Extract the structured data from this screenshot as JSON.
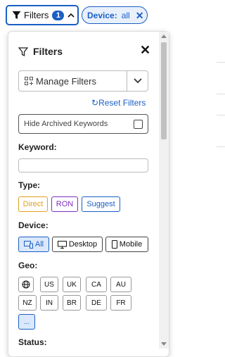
{
  "topbar": {
    "filters_label": "Filters",
    "filters_count": "1",
    "device_chip_key": "Device:",
    "device_chip_value": "all",
    "device_chip_remove": "✕"
  },
  "panel": {
    "title": "Filters",
    "close": "✕",
    "manage_filters": "Manage Filters",
    "reset_filters": "Reset Filters",
    "hide_archived": "Hide Archived Keywords",
    "keyword_label": "Keyword:",
    "keyword_value": "",
    "type_label": "Type:",
    "types": [
      "Direct",
      "RON",
      "Suggest"
    ],
    "device_label": "Device:",
    "devices": [
      "All",
      "Desktop",
      "Mobile"
    ],
    "geo_label": "Geo:",
    "geo_row1": [
      "US",
      "UK",
      "CA",
      "AU"
    ],
    "geo_row2": [
      "NZ",
      "IN",
      "BR",
      "DE",
      "FR"
    ],
    "geo_more": "...",
    "status_label": "Status:"
  },
  "colors": {
    "accent": "#1a5fc4",
    "direct": "#e0a020",
    "ron": "#7b2fbf"
  }
}
